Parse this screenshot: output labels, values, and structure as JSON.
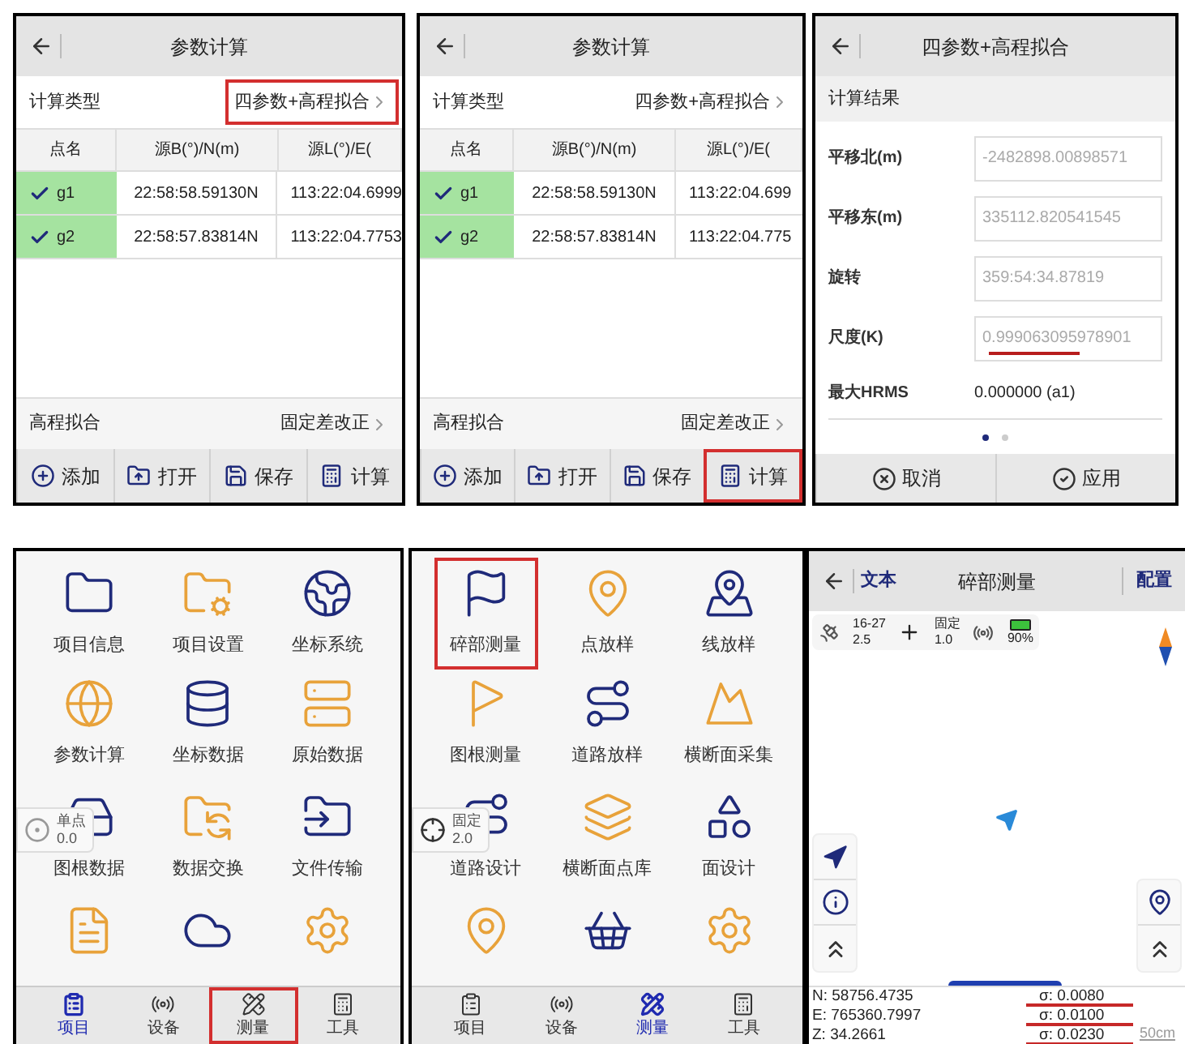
{
  "calc_screens": [
    {
      "title": "参数计算",
      "type_label": "计算类型",
      "type_value": "四参数+高程拟合",
      "type_highlighted": true,
      "columns": [
        "点名",
        "源B(°)/N(m)",
        "源L(°)/E("
      ],
      "rows": [
        {
          "name": "g1",
          "checked": true,
          "b": "22:58:58.59130N",
          "l": "113:22:04.6999"
        },
        {
          "name": "g2",
          "checked": true,
          "b": "22:58:57.83814N",
          "l": "113:22:04.7753"
        }
      ],
      "fit_label": "高程拟合",
      "fit_value": "固定差改正",
      "actions": [
        {
          "kind": "add",
          "label": "添加",
          "highlighted": false
        },
        {
          "kind": "open",
          "label": "打开",
          "highlighted": false
        },
        {
          "kind": "save",
          "label": "保存",
          "highlighted": false
        },
        {
          "kind": "calc",
          "label": "计算",
          "highlighted": false
        }
      ]
    },
    {
      "title": "参数计算",
      "type_label": "计算类型",
      "type_value": "四参数+高程拟合",
      "type_highlighted": false,
      "columns": [
        "点名",
        "源B(°)/N(m)",
        "源L(°)/E("
      ],
      "rows": [
        {
          "name": "g1",
          "checked": true,
          "b": "22:58:58.59130N",
          "l": "113:22:04.699"
        },
        {
          "name": "g2",
          "checked": true,
          "b": "22:58:57.83814N",
          "l": "113:22:04.775"
        }
      ],
      "fit_label": "高程拟合",
      "fit_value": "固定差改正",
      "actions": [
        {
          "kind": "add",
          "label": "添加",
          "highlighted": false
        },
        {
          "kind": "open",
          "label": "打开",
          "highlighted": false
        },
        {
          "kind": "save",
          "label": "保存",
          "highlighted": false
        },
        {
          "kind": "calc",
          "label": "计算",
          "highlighted": true
        }
      ]
    }
  ],
  "result_screen": {
    "title": "四参数+高程拟合",
    "section": "计算结果",
    "fields": [
      {
        "label": "平移北(m)",
        "value": "-2482898.00898571",
        "marked": false
      },
      {
        "label": "平移东(m)",
        "value": "335112.820541545",
        "marked": false
      },
      {
        "label": "旋转",
        "value": "359:54:34.87819",
        "marked": false
      },
      {
        "label": "尺度(K)",
        "value": "0.999063095978901",
        "marked": true
      }
    ],
    "max_label": "最大HRMS",
    "max_value": "0.000000 (a1)",
    "pages": [
      {
        "selected": true
      },
      {
        "selected": false
      }
    ],
    "buttons": [
      {
        "kind": "cancel",
        "label": "取消"
      },
      {
        "kind": "apply",
        "label": "应用"
      }
    ]
  },
  "menu_screens": [
    {
      "items": [
        {
          "kind": "folder",
          "label": "项目信息",
          "highlighted": false
        },
        {
          "kind": "folder-gear",
          "label": "项目设置",
          "highlighted": false
        },
        {
          "kind": "globe-pin",
          "label": "坐标系统",
          "highlighted": false
        },
        {
          "kind": "globe",
          "label": "参数计算",
          "highlighted": false
        },
        {
          "kind": "database",
          "label": "坐标数据",
          "highlighted": false
        },
        {
          "kind": "server",
          "label": "原始数据",
          "highlighted": false
        },
        {
          "kind": "drive",
          "label": "图根数据",
          "highlighted": false
        },
        {
          "kind": "folder-sync",
          "label": "数据交换",
          "highlighted": false
        },
        {
          "kind": "folder-input",
          "label": "文件传输",
          "highlighted": false
        },
        {
          "kind": "document",
          "highlighted": false
        },
        {
          "kind": "cloud",
          "highlighted": false
        },
        {
          "kind": "gear",
          "highlighted": false
        }
      ],
      "overlay": {
        "kind": "target",
        "mode": "单点",
        "value": "0.0"
      },
      "tabs": [
        {
          "kind": "project",
          "label": "项目",
          "selected": true,
          "highlighted": false
        },
        {
          "kind": "device",
          "label": "设备",
          "selected": false,
          "highlighted": false
        },
        {
          "kind": "survey",
          "label": "测量",
          "selected": false,
          "highlighted": true
        },
        {
          "kind": "tools",
          "label": "工具",
          "selected": false,
          "highlighted": false
        }
      ]
    },
    {
      "items": [
        {
          "kind": "flag",
          "label": "碎部测量",
          "highlighted": true
        },
        {
          "kind": "pin",
          "label": "点放样",
          "highlighted": false
        },
        {
          "kind": "pin-line",
          "label": "线放样",
          "highlighted": false
        },
        {
          "kind": "flag-points",
          "label": "图根测量",
          "highlighted": false
        },
        {
          "kind": "road",
          "label": "道路放样",
          "highlighted": false
        },
        {
          "kind": "mountain",
          "label": "横断面采集",
          "highlighted": false
        },
        {
          "kind": "road",
          "label": "道路设计",
          "highlighted": false
        },
        {
          "kind": "layers",
          "label": "横断面点库",
          "highlighted": false
        },
        {
          "kind": "shapes",
          "label": "面设计",
          "highlighted": false
        },
        {
          "kind": "pin",
          "highlighted": false
        },
        {
          "kind": "basket",
          "highlighted": false
        },
        {
          "kind": "gear",
          "highlighted": false
        }
      ],
      "overlay": {
        "kind": "cross",
        "mode": "固定",
        "value": "2.0"
      },
      "tabs": [
        {
          "kind": "project",
          "label": "项目",
          "selected": false,
          "highlighted": false
        },
        {
          "kind": "device",
          "label": "设备",
          "selected": false,
          "highlighted": false
        },
        {
          "kind": "survey",
          "label": "测量",
          "selected": true,
          "highlighted": false
        },
        {
          "kind": "tools",
          "label": "工具",
          "selected": false,
          "highlighted": false
        }
      ]
    }
  ],
  "survey_screen": {
    "back_label": "文本",
    "title": "碎部测量",
    "config": "配置",
    "status": {
      "satellites": "16-27",
      "pdop": "2.5",
      "solution": "固定",
      "precision": "1.0",
      "battery": "90%"
    },
    "coords": [
      {
        "label": "N:",
        "value": "58756.4735",
        "sigma": "σ: 0.0080",
        "marked": true
      },
      {
        "label": "E:",
        "value": "765360.7997",
        "sigma": "σ: 0.0100",
        "marked": true
      },
      {
        "label": "Z:",
        "value": "34.2661",
        "sigma": "σ: 0.0230",
        "marked": true
      }
    ],
    "scale": "50cm"
  }
}
